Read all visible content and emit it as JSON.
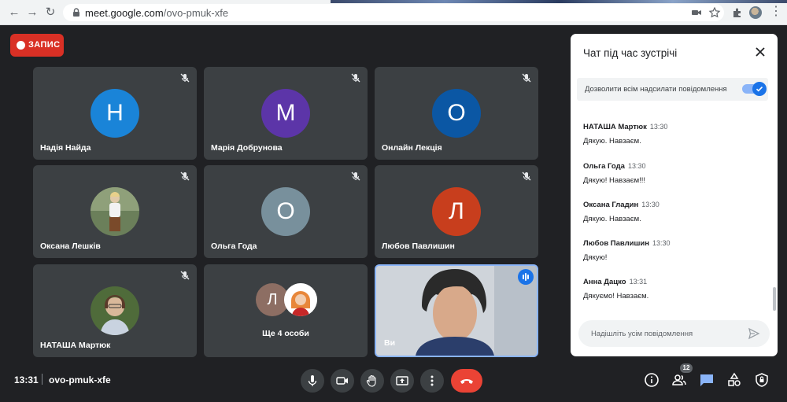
{
  "browser": {
    "url_host": "meet.google.com",
    "url_path": "/ovo-pmuk-xfe",
    "icons": [
      "back-arrow-icon",
      "forward-arrow-icon",
      "reload-icon",
      "lock-icon",
      "camera-blocked-icon",
      "star-icon",
      "extensions-icon",
      "profile-avatar",
      "menu-dots-icon"
    ]
  },
  "record": {
    "label": "ЗАПИС"
  },
  "participants": [
    {
      "name": "Надія Найда",
      "initial": "Н",
      "color": "#1a84d8"
    },
    {
      "name": "Марія Добрунова",
      "initial": "М",
      "color": "#5c35a8"
    },
    {
      "name": "Онлайн Лекція",
      "initial": "О",
      "color": "#0b57a4"
    },
    {
      "name": "Оксана Лешків",
      "initial": "",
      "color": "#3c4043"
    },
    {
      "name": "Ольга Года",
      "initial": "О",
      "color": "#78909c"
    },
    {
      "name": "Любов Павлишин",
      "initial": "Л",
      "color": "#c83e1d"
    },
    {
      "name": "НАТАША Мартюк",
      "initial": "",
      "color": "#3c4043"
    }
  ],
  "more_tile": {
    "initial": "Л",
    "initial_color": "#8d6e63",
    "label": "Ще 4 особи"
  },
  "self_tile": {
    "name": "Ви"
  },
  "bottom": {
    "time": "13:31",
    "meeting_code": "ovo-pmuk-xfe",
    "people_count": "12"
  },
  "chat": {
    "title": "Чат під час зустрічі",
    "allow_label": "Дозволити всім надсилати повідомлення",
    "allow_enabled": true,
    "messages": [
      {
        "from": "НАТАША Мартюк",
        "time": "13:30",
        "text": "Дякую. Навзаєм."
      },
      {
        "from": "Ольга Года",
        "time": "13:30",
        "text": "Дякую! Навзаєм!!!"
      },
      {
        "from": "Оксана Гладин",
        "time": "13:30",
        "text": "Дякую. Навзаєм."
      },
      {
        "from": "Любов Павлишин",
        "time": "13:30",
        "text": "Дякую!"
      },
      {
        "from": "Анна Дацко",
        "time": "13:31",
        "text": "Дякуємо! Навзаєм."
      }
    ],
    "input_placeholder": "Надішліть усім повідомлення",
    "input_value": ""
  },
  "colors": {
    "background": "#202124",
    "tile": "#3c4043",
    "accent": "#1a73e8",
    "danger": "#d93025"
  }
}
